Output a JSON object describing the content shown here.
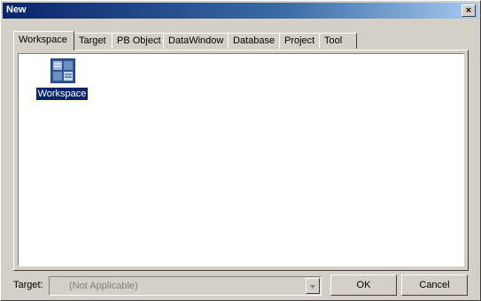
{
  "window": {
    "title": "New",
    "close_glyph": "×"
  },
  "tabs": [
    {
      "label": "Workspace",
      "active": true
    },
    {
      "label": "Target"
    },
    {
      "label": "PB Object"
    },
    {
      "label": "DataWindow"
    },
    {
      "label": "Database"
    },
    {
      "label": "Project"
    },
    {
      "label": "Tool"
    }
  ],
  "items": [
    {
      "label": "Workspace",
      "icon": "workspace-icon",
      "selected": true
    }
  ],
  "footer": {
    "target_label": "Target:",
    "target_value": "(Not Applicable)",
    "ok_label": "OK",
    "cancel_label": "Cancel"
  },
  "colors": {
    "titlebar_start": "#0a246a",
    "titlebar_end": "#a6caf0",
    "selection": "#0a246a",
    "face": "#d4d0c8"
  }
}
